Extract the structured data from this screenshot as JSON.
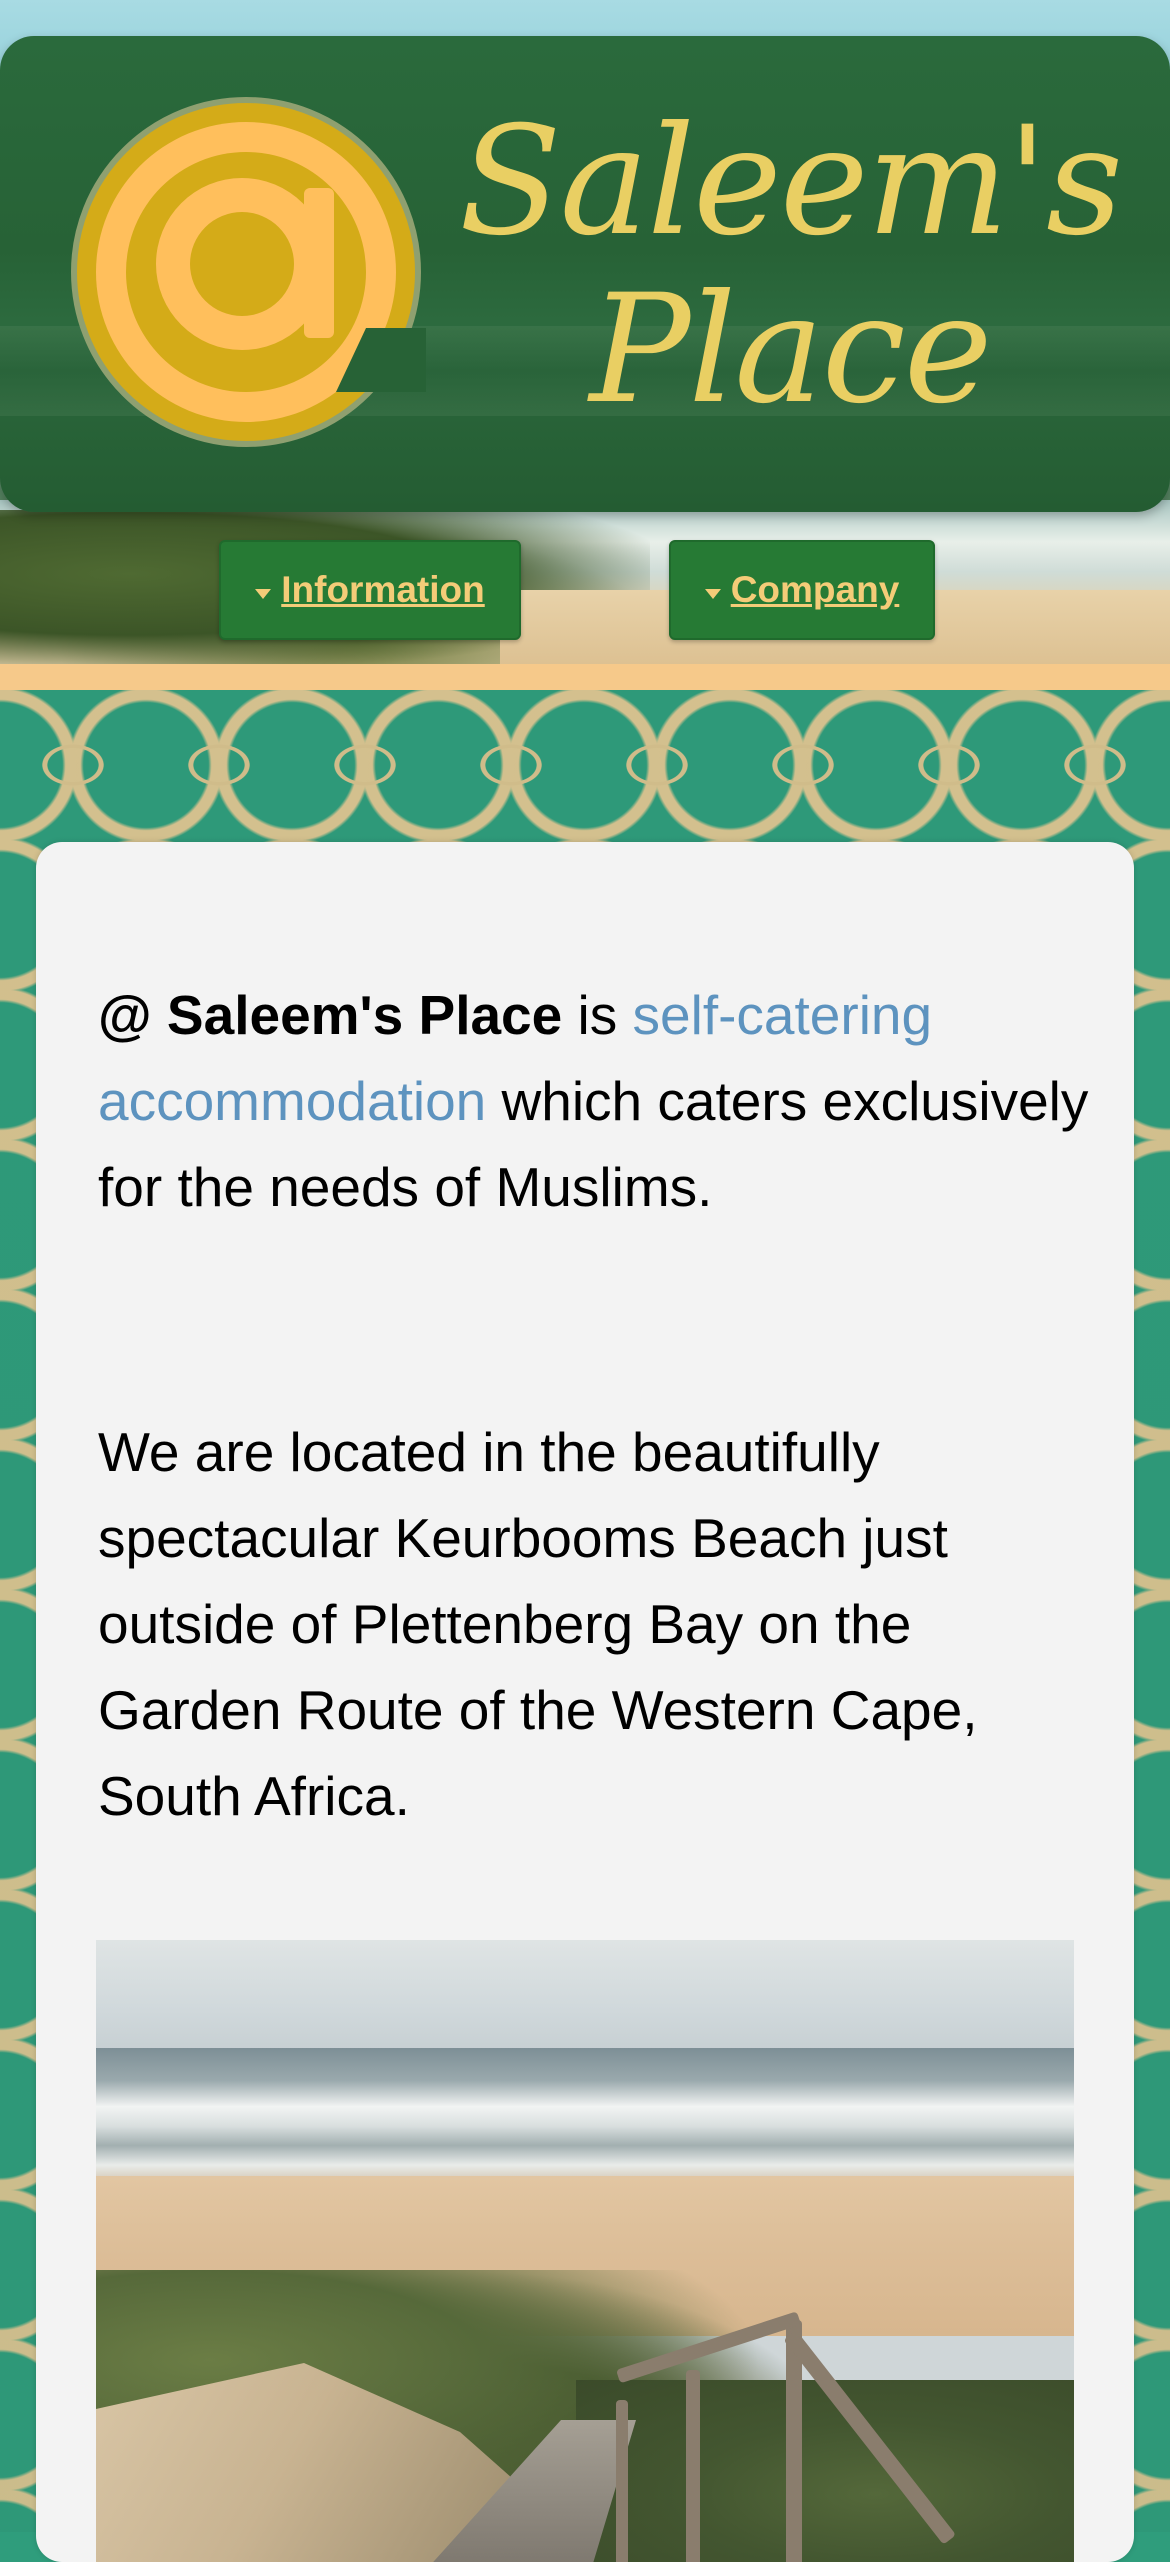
{
  "brand": {
    "logo_symbol": "@",
    "title_line1": "Saleem's",
    "title_line2": "Place"
  },
  "nav": {
    "information_label": "Information",
    "company_label": "Company",
    "caret_icon": "caret-down-icon"
  },
  "intro": {
    "at_symbol": "@",
    "name_bold": "Saleem's Place",
    "text_is": " is ",
    "link_text": "self-catering accommodation",
    "text_rest": " which caters exclusively for the needs of Muslims."
  },
  "location": {
    "text": "We are located in the beautifully spectacular Keurbooms Beach just outside of Plettenberg Bay on the Garden Route of the Western Cape, South Africa."
  },
  "colors": {
    "banner_green": "#276236",
    "title_gold": "#e9cf63",
    "nav_text": "#f4cc78",
    "link_blue": "#5d93bf",
    "pattern_teal": "#2f9d7c",
    "card_bg": "#f3f3f3"
  }
}
